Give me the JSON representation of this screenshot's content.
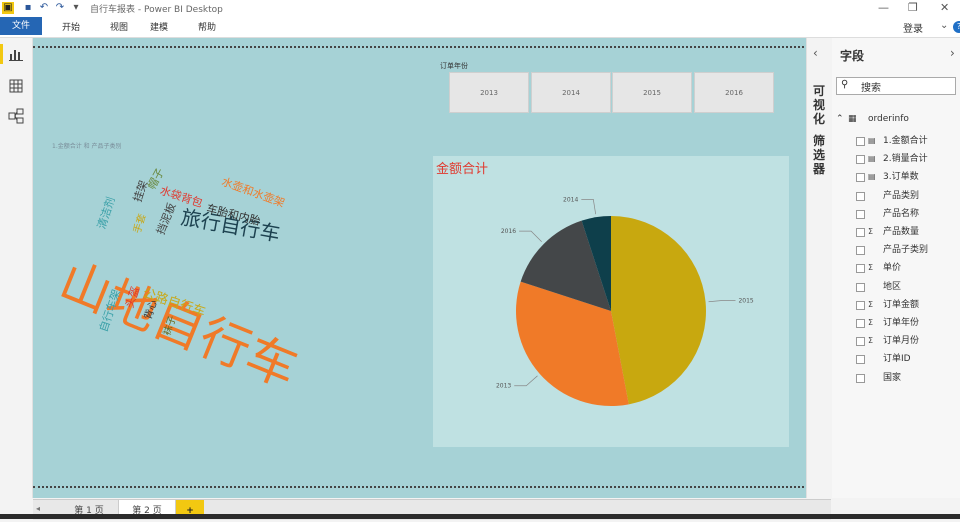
{
  "window": {
    "title": "自行车报表 - Power BI Desktop",
    "login": "登录",
    "help": "?"
  },
  "ribbon": {
    "file": "文件",
    "tabs": [
      "开始",
      "视图",
      "建模",
      "帮助"
    ]
  },
  "left_nav": {
    "icons": [
      "report-view-icon",
      "data-view-icon",
      "model-view-icon"
    ]
  },
  "canvas": {
    "slicer": {
      "title": "订单年份",
      "options": [
        "2013",
        "2014",
        "2015",
        "2016"
      ]
    },
    "wordcloud": {
      "title": "1.金额合计 和 产品子类别",
      "words": [
        {
          "text": "山地自行车",
          "color": "#f07a28"
        },
        {
          "text": "旅行自行车",
          "color": "#1d4250"
        },
        {
          "text": "公路自行车",
          "color": "#c8a818"
        },
        {
          "text": "车胎和内胎",
          "color": "#333333"
        },
        {
          "text": "水壶和水壶架",
          "color": "#f07a28"
        },
        {
          "text": "水袋背包",
          "color": "#e0392f"
        },
        {
          "text": "挡泥板",
          "color": "#444444"
        },
        {
          "text": "挂架",
          "color": "#444444"
        },
        {
          "text": "帽子",
          "color": "#6a8a40"
        },
        {
          "text": "清洁剂",
          "color": "#3aa0a8"
        },
        {
          "text": "手套",
          "color": "#c8a818"
        },
        {
          "text": "自行车架",
          "color": "#3aa0a8"
        },
        {
          "text": "头盔",
          "color": "#e0392f"
        },
        {
          "text": "背心",
          "color": "#333333"
        },
        {
          "text": "袜子",
          "color": "#6a6a20"
        }
      ]
    },
    "pie": {
      "title": "金额合计"
    }
  },
  "chart_data": {
    "type": "pie",
    "title": "金额合计",
    "categories": [
      "2015",
      "2013",
      "2016",
      "2014"
    ],
    "values": [
      47,
      33,
      15,
      5
    ],
    "colors": [
      "#c8a80f",
      "#f07a28",
      "#444749",
      "#0e3f4b"
    ]
  },
  "side_tabs": {
    "visualizations": "可视化",
    "filters": "筛选器"
  },
  "fields_pane": {
    "title": "字段",
    "search_placeholder": "搜索",
    "table": "orderinfo",
    "fields": [
      {
        "name": "1.金额合计",
        "icon": "measure-icon"
      },
      {
        "name": "2.销量合计",
        "icon": "measure-icon"
      },
      {
        "name": "3.订单数",
        "icon": "measure-icon"
      },
      {
        "name": "产品类别",
        "icon": ""
      },
      {
        "name": "产品名称",
        "icon": ""
      },
      {
        "name": "产品数量",
        "icon": "sigma-icon"
      },
      {
        "name": "产品子类别",
        "icon": ""
      },
      {
        "name": "单价",
        "icon": "sigma-icon"
      },
      {
        "name": "地区",
        "icon": ""
      },
      {
        "name": "订单金额",
        "icon": "sigma-icon"
      },
      {
        "name": "订单年份",
        "icon": "sigma-icon"
      },
      {
        "name": "订单月份",
        "icon": "sigma-icon"
      },
      {
        "name": "订单ID",
        "icon": ""
      },
      {
        "name": "国家",
        "icon": ""
      }
    ]
  },
  "pages": {
    "tabs": [
      "第 1 页",
      "第 2 页"
    ],
    "add": "+"
  }
}
